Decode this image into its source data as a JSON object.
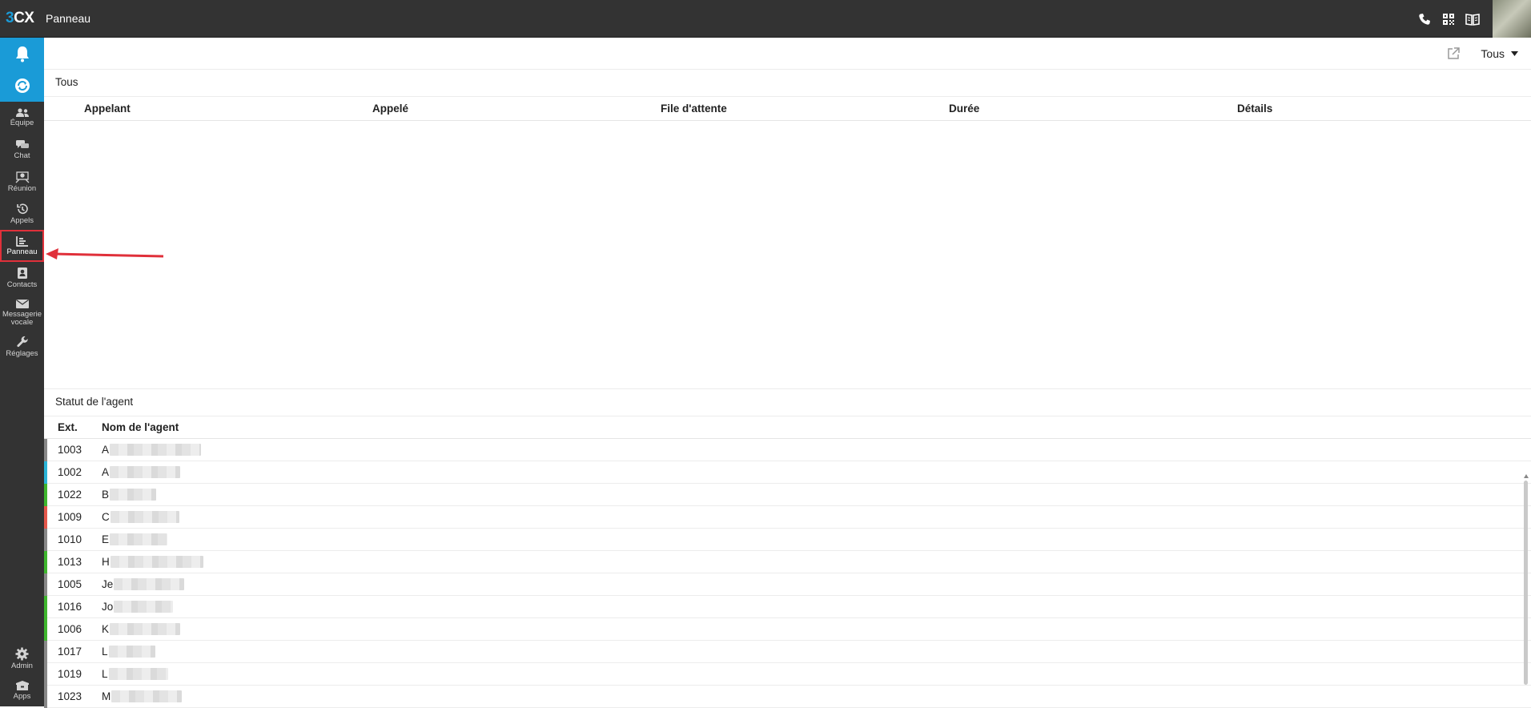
{
  "topbar": {
    "logo_prefix": "3",
    "logo_suffix": "CX",
    "title": "Panneau"
  },
  "sidebar": {
    "items": [
      {
        "label": "Équipe"
      },
      {
        "label": "Chat"
      },
      {
        "label": "Réunion"
      },
      {
        "label": "Appels"
      },
      {
        "label": "Panneau"
      },
      {
        "label": "Contacts"
      },
      {
        "label": "Messagerie vocale"
      },
      {
        "label": "Réglages"
      }
    ],
    "bottom": [
      {
        "label": "Admin"
      },
      {
        "label": "Apps"
      }
    ]
  },
  "toolbar": {
    "filter_value": "Tous"
  },
  "calls": {
    "title": "Tous",
    "columns": [
      "Appelant",
      "Appelé",
      "File d'attente",
      "Durée",
      "Détails"
    ]
  },
  "agents": {
    "title": "Statut de l'agent",
    "columns": [
      "Ext.",
      "Nom de l'agent"
    ],
    "rows": [
      {
        "ext": "1003",
        "initial": "A",
        "status": "#888888"
      },
      {
        "ext": "1002",
        "initial": "A",
        "status": "#2ab4d8"
      },
      {
        "ext": "1022",
        "initial": "B",
        "status": "#3fb62e"
      },
      {
        "ext": "1009",
        "initial": "C",
        "status": "#e5574b"
      },
      {
        "ext": "1010",
        "initial": "E",
        "status": "#888888"
      },
      {
        "ext": "1013",
        "initial": "H",
        "status": "#3fb62e"
      },
      {
        "ext": "1005",
        "initial": "Je",
        "status": "#888888"
      },
      {
        "ext": "1016",
        "initial": "Jo",
        "status": "#3fb62e"
      },
      {
        "ext": "1006",
        "initial": "K",
        "status": "#3fb62e"
      },
      {
        "ext": "1017",
        "initial": "L",
        "status": "#888888"
      },
      {
        "ext": "1019",
        "initial": "L",
        "status": "#888888"
      },
      {
        "ext": "1023",
        "initial": "M",
        "status": "#888888"
      }
    ]
  },
  "colors": {
    "sidebar": "#333333",
    "accent": "#1a9bd7",
    "highlight": "#e0303a"
  }
}
